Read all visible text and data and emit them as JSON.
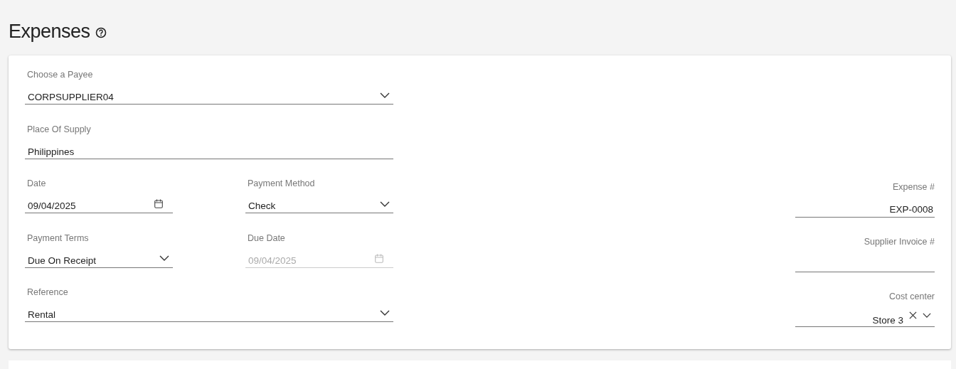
{
  "page": {
    "title": "Expenses"
  },
  "left_rows": [
    [
      {
        "label": "Choose a Payee",
        "value": "CORPSUPPLIER04",
        "kind": "select",
        "disabled": false,
        "clearable": false
      }
    ],
    [
      {
        "label": "Place Of Supply",
        "value": "Philippines",
        "kind": "text",
        "disabled": false,
        "clearable": false
      }
    ],
    [
      {
        "label": "Date",
        "value": "09/04/2025",
        "kind": "date",
        "disabled": false,
        "clearable": false
      },
      {
        "label": "Payment Method",
        "value": "Check",
        "kind": "select",
        "disabled": false,
        "clearable": false
      }
    ],
    [
      {
        "label": "Payment Terms",
        "value": "Due On Receipt",
        "kind": "select",
        "disabled": false,
        "clearable": false
      },
      {
        "label": "Due Date",
        "value": "09/04/2025",
        "kind": "date",
        "disabled": true,
        "clearable": false
      }
    ],
    [
      {
        "label": "Reference",
        "value": "Rental",
        "kind": "select",
        "disabled": false,
        "clearable": false
      }
    ]
  ],
  "right_fields": [
    {
      "label": "Expense #",
      "value": "EXP-0008",
      "kind": "text",
      "disabled": false,
      "clearable": false
    },
    {
      "label": "Supplier Invoice #",
      "kind": "text",
      "disabled": false,
      "clearable": false
    },
    {
      "label": "Cost center",
      "value": "Store 3",
      "kind": "select",
      "disabled": false,
      "clearable": true
    }
  ]
}
